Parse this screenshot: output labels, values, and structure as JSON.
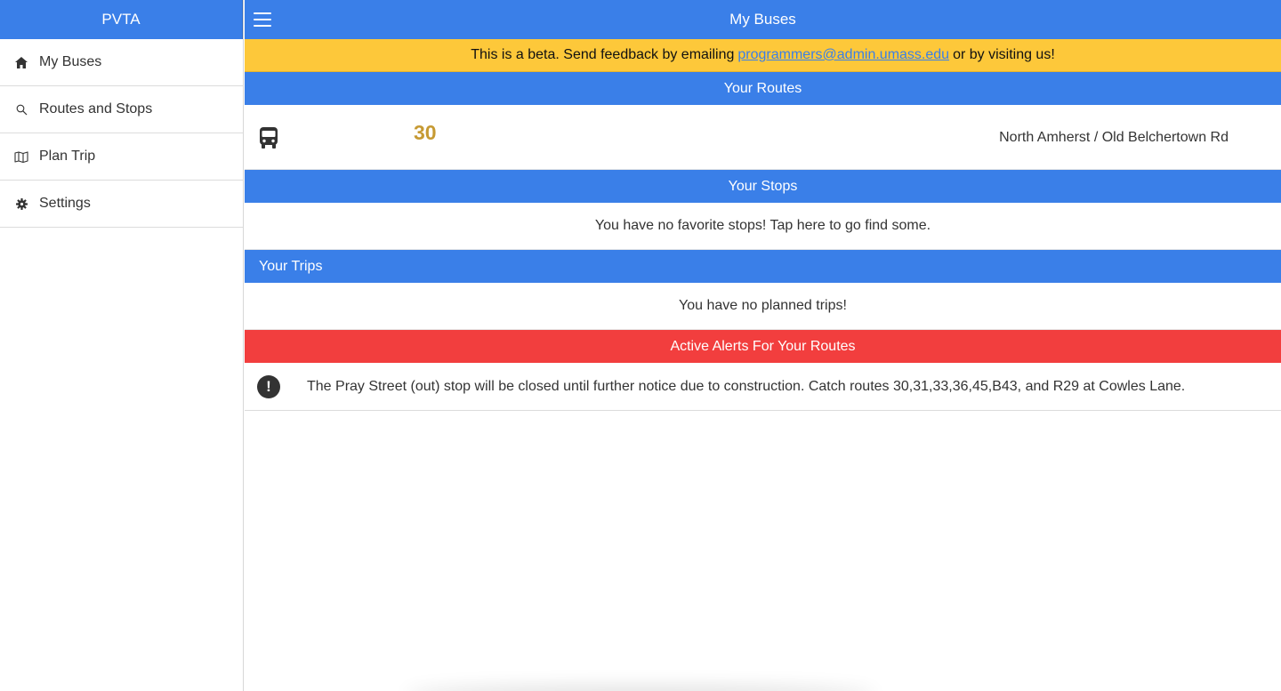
{
  "sidebar": {
    "title": "PVTA",
    "items": [
      {
        "label": "My Buses",
        "icon": "home-icon"
      },
      {
        "label": "Routes and Stops",
        "icon": "search-icon"
      },
      {
        "label": "Plan Trip",
        "icon": "map-icon"
      },
      {
        "label": "Settings",
        "icon": "gear-icon"
      }
    ]
  },
  "header": {
    "title": "My Buses",
    "menu_icon": "hamburger-menu-icon"
  },
  "beta_banner": {
    "prefix": "This is a beta. Send feedback by emailing",
    "email": "programmers@admin.umass.edu",
    "suffix": "or by visiting us!",
    "color": "#fdc83a"
  },
  "routes": {
    "heading": "Your Routes",
    "items": [
      {
        "icon": "bus-icon",
        "number": "30",
        "name": "North Amherst / Old Belchertown Rd",
        "number_color": "#c69a33"
      }
    ]
  },
  "stops": {
    "heading": "Your Stops",
    "empty_message": "You have no favorite stops! Tap here to go find some."
  },
  "trips": {
    "heading": "Your Trips",
    "empty_message": "You have no planned trips!"
  },
  "alerts": {
    "heading": "Active Alerts For Your Routes",
    "color": "#f23e3e",
    "items": [
      {
        "icon": "alert-exclamation-icon",
        "glyph": "!",
        "text": "The Pray Street (out) stop will be closed until further notice due to construction. Catch routes 30,31,33,36,45,B43, and R29 at Cowles Lane."
      }
    ]
  },
  "colors": {
    "primary": "#3a7fe8",
    "beta": "#fdc83a",
    "alert": "#f23e3e"
  }
}
